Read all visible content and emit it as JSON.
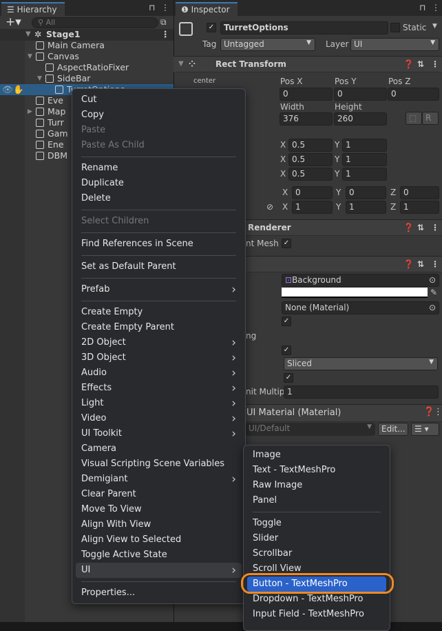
{
  "hierarchy": {
    "tab": "Hierarchy",
    "search_placeholder": "All",
    "scene": "Stage1",
    "rows": [
      {
        "label": "Main Camera",
        "indent": 1
      },
      {
        "label": "Canvas",
        "indent": 1,
        "expanded": true
      },
      {
        "label": "AspectRatioFixer",
        "indent": 2
      },
      {
        "label": "SideBar",
        "indent": 2,
        "expanded": true
      },
      {
        "label": "TurretOptions",
        "indent": 3,
        "selected": true
      },
      {
        "label": "Eve",
        "indent": 1
      },
      {
        "label": "Map",
        "indent": 1,
        "collapsed": true
      },
      {
        "label": "Turr",
        "indent": 1
      },
      {
        "label": "Gam",
        "indent": 1
      },
      {
        "label": "Ene",
        "indent": 1
      },
      {
        "label": "DBM",
        "indent": 1
      }
    ]
  },
  "inspector": {
    "tab": "Inspector",
    "object_name": "TurretOptions",
    "static_label": "Static",
    "tag_label": "Tag",
    "tag_value": "Untagged",
    "layer_label": "Layer",
    "layer_value": "UI",
    "rect_transform": {
      "title": "Rect Transform",
      "anchor": "center",
      "posx_label": "Pos X",
      "posy_label": "Pos Y",
      "posz_label": "Pos Z",
      "posx": "0",
      "posy": "0",
      "posz": "0",
      "width_label": "Width",
      "height_label": "Height",
      "width": "376",
      "height": "260",
      "r_label": "R",
      "anchor_rows": [
        {
          "x": "0.5",
          "y": "1"
        },
        {
          "x": "0.5",
          "y": "1"
        },
        {
          "x": "0.5",
          "y": "1"
        }
      ],
      "rotation": {
        "x": "0",
        "y": "0",
        "z": "0"
      },
      "scale": {
        "x": "1",
        "y": "1",
        "z": "1"
      }
    },
    "renderer": {
      "title": "Renderer",
      "cull_label": "nt Mesh"
    },
    "image": {
      "sprite": "Background",
      "color": "#ffffff",
      "material": "None (Material)",
      "ng_label": "ng",
      "image_type": "Sliced",
      "ppu_label": "nit Multip",
      "ppu": "1"
    },
    "material": {
      "title": "UI Material (Material)",
      "shader": "UI/Default",
      "edit": "Edit..."
    }
  },
  "context_menu": {
    "items": [
      {
        "label": "Cut"
      },
      {
        "label": "Copy"
      },
      {
        "label": "Paste",
        "disabled": true
      },
      {
        "label": "Paste As Child",
        "disabled": true
      },
      {
        "sep": true
      },
      {
        "label": "Rename"
      },
      {
        "label": "Duplicate"
      },
      {
        "label": "Delete"
      },
      {
        "sep": true
      },
      {
        "label": "Select Children",
        "disabled": true
      },
      {
        "sep": true
      },
      {
        "label": "Find References in Scene"
      },
      {
        "sep": true
      },
      {
        "label": "Set as Default Parent"
      },
      {
        "sep": true
      },
      {
        "label": "Prefab",
        "submenu": true
      },
      {
        "sep": true
      },
      {
        "label": "Create Empty"
      },
      {
        "label": "Create Empty Parent"
      },
      {
        "label": "2D Object",
        "submenu": true
      },
      {
        "label": "3D Object",
        "submenu": true
      },
      {
        "label": "Audio",
        "submenu": true
      },
      {
        "label": "Effects",
        "submenu": true
      },
      {
        "label": "Light",
        "submenu": true
      },
      {
        "label": "Video",
        "submenu": true
      },
      {
        "label": "UI Toolkit",
        "submenu": true
      },
      {
        "label": "Camera"
      },
      {
        "label": "Visual Scripting Scene Variables"
      },
      {
        "label": "Demigiant",
        "submenu": true
      },
      {
        "label": "Clear Parent"
      },
      {
        "label": "Move To View"
      },
      {
        "label": "Align With View"
      },
      {
        "label": "Align View to Selected"
      },
      {
        "label": "Toggle Active State"
      },
      {
        "label": "UI",
        "submenu": true,
        "highlighted": true
      },
      {
        "sep": true
      },
      {
        "label": "Properties..."
      }
    ]
  },
  "ui_submenu": {
    "items": [
      {
        "label": "Image"
      },
      {
        "label": "Text - TextMeshPro"
      },
      {
        "label": "Raw Image"
      },
      {
        "label": "Panel"
      },
      {
        "sep": true
      },
      {
        "label": "Toggle"
      },
      {
        "label": "Slider"
      },
      {
        "label": "Scrollbar"
      },
      {
        "label": "Scroll View"
      },
      {
        "label": "Button - TextMeshPro",
        "selected": true
      },
      {
        "label": "Dropdown - TextMeshPro"
      },
      {
        "label": "Input Field - TextMeshPro"
      }
    ]
  },
  "colors": {
    "selection": "#2a62c9",
    "highlight_ring": "#f08a24",
    "hierarchy_selected_row": "#2c5d87"
  }
}
